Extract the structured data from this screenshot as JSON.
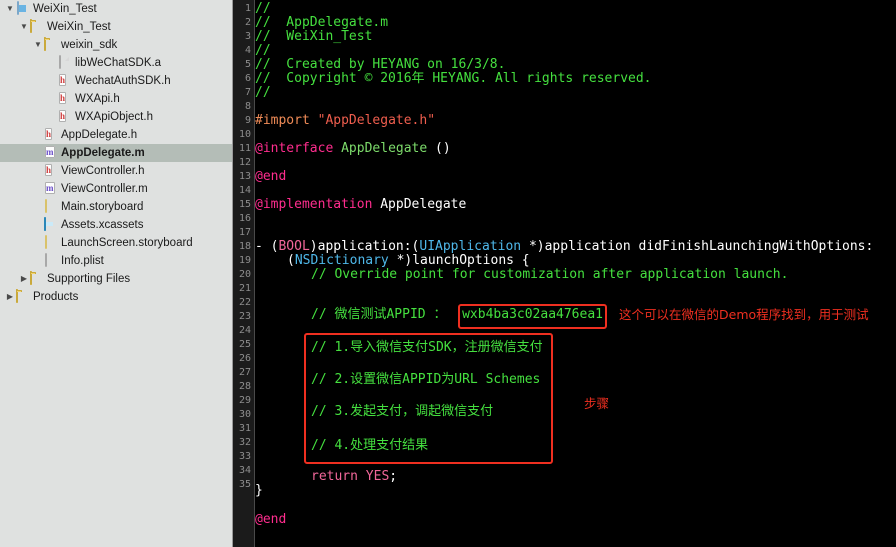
{
  "sidebar": {
    "items": [
      {
        "label": "WeiXin_Test",
        "icon": "project-icon",
        "indent": 0,
        "twisty": "open",
        "selected": false
      },
      {
        "label": "WeiXin_Test",
        "icon": "folder-icon",
        "indent": 1,
        "twisty": "open",
        "selected": false
      },
      {
        "label": "weixin_sdk",
        "icon": "folder-icon",
        "indent": 2,
        "twisty": "open",
        "selected": false
      },
      {
        "label": "libWeChatSDK.a",
        "icon": "library-icon",
        "indent": 3,
        "twisty": "none",
        "selected": false
      },
      {
        "label": "WechatAuthSDK.h",
        "icon": "header-icon",
        "indent": 3,
        "twisty": "none",
        "selected": false
      },
      {
        "label": "WXApi.h",
        "icon": "header-icon",
        "indent": 3,
        "twisty": "none",
        "selected": false
      },
      {
        "label": "WXApiObject.h",
        "icon": "header-icon",
        "indent": 3,
        "twisty": "none",
        "selected": false
      },
      {
        "label": "AppDelegate.h",
        "icon": "header-icon",
        "indent": 2,
        "twisty": "none",
        "selected": false
      },
      {
        "label": "AppDelegate.m",
        "icon": "source-icon",
        "indent": 2,
        "twisty": "none",
        "selected": true
      },
      {
        "label": "ViewController.h",
        "icon": "header-icon",
        "indent": 2,
        "twisty": "none",
        "selected": false
      },
      {
        "label": "ViewController.m",
        "icon": "source-icon",
        "indent": 2,
        "twisty": "none",
        "selected": false
      },
      {
        "label": "Main.storyboard",
        "icon": "storyboard-icon",
        "indent": 2,
        "twisty": "none",
        "selected": false
      },
      {
        "label": "Assets.xcassets",
        "icon": "assets-icon",
        "indent": 2,
        "twisty": "none",
        "selected": false
      },
      {
        "label": "LaunchScreen.storyboard",
        "icon": "storyboard-icon",
        "indent": 2,
        "twisty": "none",
        "selected": false
      },
      {
        "label": "Info.plist",
        "icon": "plist-icon",
        "indent": 2,
        "twisty": "none",
        "selected": false
      },
      {
        "label": "Supporting Files",
        "icon": "folder-icon",
        "indent": 1,
        "twisty": "closed",
        "selected": false
      },
      {
        "label": "Products",
        "icon": "folder-icon",
        "indent": 0,
        "twisty": "closed",
        "selected": false
      }
    ]
  },
  "editor": {
    "file_name": "AppDelegate.m",
    "line_numbers": [
      1,
      2,
      3,
      4,
      5,
      6,
      7,
      8,
      9,
      10,
      11,
      12,
      13,
      14,
      15,
      16,
      17,
      18,
      19,
      20,
      21,
      22,
      23,
      24,
      25,
      26,
      27,
      28,
      29,
      30,
      31,
      32,
      33,
      34,
      35
    ],
    "lines": {
      "l1": "//",
      "l2": "//  AppDelegate.m",
      "l3": "//  WeiXin_Test",
      "l4": "//",
      "l5": "//  Created by HEYANG on 16/3/8.",
      "l6": "//  Copyright © 2016年 HEYANG. All rights reserved.",
      "l7": "//",
      "l9_kw": "#import",
      "l9_str": "\"AppDelegate.h\"",
      "l11_kw": "@interface",
      "l11_cls": "AppDelegate",
      "l11_tail": "()",
      "l13_kw": "@end",
      "l15_kw": "@implementation",
      "l15_cls": "AppDelegate",
      "l18_a": "- (",
      "l18_bool": "BOOL",
      "l18_b": ")application:(",
      "l18_uiapp": "UIApplication",
      "l18_c": " *)application didFinishLaunchingWithOptions:",
      "l18_d": "(",
      "l18_nsdict": "NSDictionary",
      "l18_e": " *)launchOptions {",
      "l19": "// Override point for customization after application launch.",
      "l21_pre": "// 微信测试APPID ：",
      "l21_appid": "wxb4ba3c02aa476ea1",
      "l23": "// 1.导入微信支付SDK，注册微信支付",
      "l25": "// 2.设置微信APPID为URL Schemes",
      "l27": "// 3.发起支付，调起微信支付",
      "l29": "// 4.处理支付结果",
      "l31_kw": "return",
      "l31_val": "YES",
      "l31_semi": ";",
      "l32": "}",
      "l34_kw": "@end"
    }
  },
  "annotations": {
    "appid_note": "这个可以在微信的Demo程序找到，用于测试",
    "steps_label": "步骤"
  },
  "colors": {
    "annotation_red": "#ef2f20",
    "comment_green": "#45e03f",
    "keyword_magenta": "#ff2d8e",
    "class_blue": "#4fb8ea",
    "string_red": "#ef5e4e",
    "editor_bg": "#000000",
    "gutter_bg": "#1b1b1b",
    "sidebar_bg": "#dfe1e0",
    "selection_bg": "#b4bdb7"
  }
}
